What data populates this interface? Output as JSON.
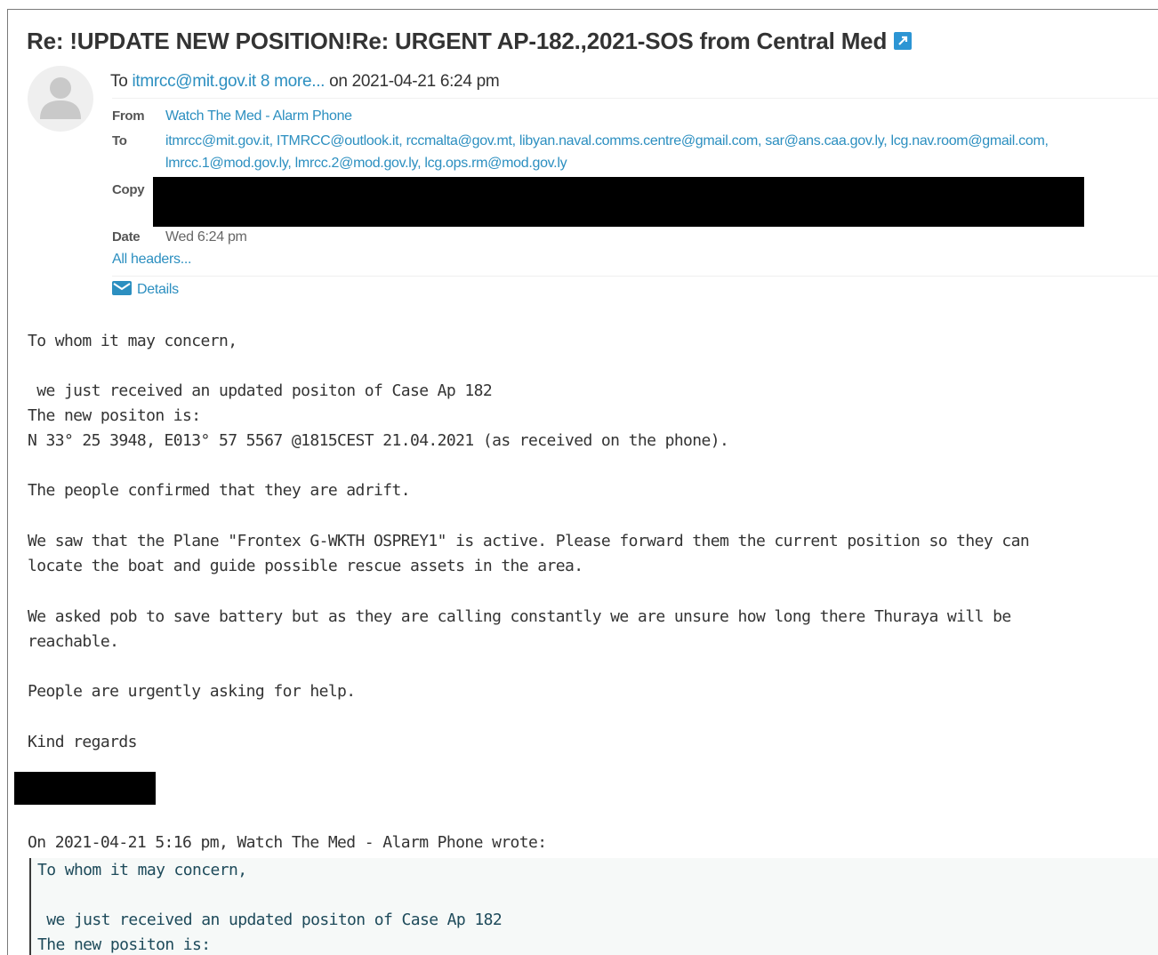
{
  "subject": "Re: !UPDATE NEW POSITION!Re: URGENT AP-182.,2021-SOS from Central Med",
  "summary": {
    "to_prefix": "To ",
    "to_link": "itmrcc@mit.gov.it 8 more...",
    "on_text": " on 2021-04-21 6:24 pm"
  },
  "headers": {
    "from_label": "From",
    "from_value": "Watch The Med - Alarm Phone",
    "to_label": "To",
    "to_line1": "itmrcc@mit.gov.it, ITMRCC@outlook.it, rccmalta@gov.mt, libyan.naval.comms.centre@gmail.com, sar@ans.caa.gov.ly, lcg.nav.room@gmail.com,",
    "to_line2": "lmrcc.1@mod.gov.ly, lmrcc.2@mod.gov.ly, lcg.ops.rm@mod.gov.ly",
    "copy_label": "Copy",
    "date_label": "Date",
    "date_value": "Wed 6:24 pm",
    "all_headers": "All headers...",
    "details": "Details"
  },
  "body": {
    "greeting": "To whom it may concern,",
    "line1": " we just received an updated positon of Case Ap 182",
    "line2": "The new positon is:",
    "line3": "N 33° 25 3948, E013° 57 5567 @1815CEST 21.04.2021 (as received on the phone).",
    "line4": "The people confirmed that they are adrift.",
    "line5": "We saw that the Plane \"Frontex G-WKTH OSPREY1\" is active. Please forward them the current position so they can",
    "line6": "locate the boat and guide possible rescue assets in the area.",
    "line7": "We asked pob to save battery but as they are calling constantly we are unsure how long there Thuraya will be",
    "line8": "reachable.",
    "line9": "People are urgently asking for help.",
    "closing": "Kind regards",
    "quote_intro": "On 2021-04-21 5:16 pm, Watch The Med - Alarm Phone wrote:"
  },
  "quote": {
    "greeting": "To whom it may concern,",
    "line1": " we just received an updated positon of Case Ap 182",
    "line2": "The new positon is:"
  },
  "colors": {
    "link": "#2c8fc0",
    "icon_accent": "#2c95d4",
    "redaction": "#000000"
  },
  "icons": [
    "external-link-icon",
    "avatar-icon",
    "mail-icon"
  ]
}
